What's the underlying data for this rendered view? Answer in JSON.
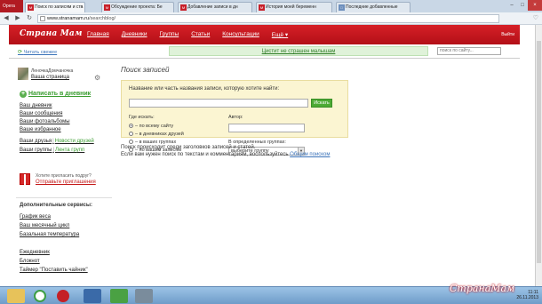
{
  "browser": {
    "menu_label": "Opera",
    "tabs": [
      {
        "label": "Поиск по записям и ста",
        "active": true
      },
      {
        "label": "Обсуждение проекта: Бе",
        "active": false
      },
      {
        "label": "Добавление записи в дн",
        "active": false
      },
      {
        "label": "История моей беременн",
        "active": false
      },
      {
        "label": "Последние добавленные",
        "active": false
      }
    ],
    "url_domain": "www.stranamam.ru",
    "url_path": "/searchblog/"
  },
  "site": {
    "logo": "Страна Мам",
    "nav": [
      "Главная",
      "Дневники",
      "Группы",
      "Статьи",
      "Консультации",
      "Ещё ▾"
    ],
    "exit": "Выйти",
    "read_fresh": "Читать свежее",
    "promo": "Цистит не страшен малышам",
    "site_search_placeholder": "поиск по сайту..."
  },
  "sidebar": {
    "username": "ЛеночкаДомчаночка",
    "my_page": "Ваша страница",
    "write": "Написать в дневник",
    "links": [
      "Ваш дневник",
      "Ваши сообщения",
      "Ваши фотоальбомы",
      "Ваше избранное"
    ],
    "friends": "Ваши друзья",
    "friends_news": "Новости друзей",
    "groups": "Ваши группы",
    "groups_feed": "Лента групп",
    "invite_q": "Хотите пригласить подруг?",
    "invite_a": "Отправьте приглашения",
    "services_title": "Дополнительные сервисы:",
    "services": [
      "График веса",
      "Ваш месячный цикл",
      "Базальная температура"
    ],
    "services2": [
      "Ежедневник",
      "Блокнот",
      "Таймер \"Поставить чайник\""
    ]
  },
  "main": {
    "title": "Поиск записей",
    "search_label": "Название или часть названия записи, которую хотите найти:",
    "search_button": "Искать",
    "where_label": "Где искать:",
    "radios": [
      "– по всему сайту",
      "– в дневниках друзей",
      "– в ваших группах",
      "– по вашим записям"
    ],
    "author_label": "Автор:",
    "groups_label": "В определенных группах:",
    "groups_select": "выберите группу",
    "note_line1": "Поиск происходит среди заголовков записей и статей.",
    "note_line2": "Если вам нужен поиск по текстам и комментариям, воспользуйтесь",
    "note_link": "Общим поиском"
  },
  "taskbar": {
    "time": "11:11",
    "date": "26.11.2013"
  },
  "watermark": "СтранаМам"
}
